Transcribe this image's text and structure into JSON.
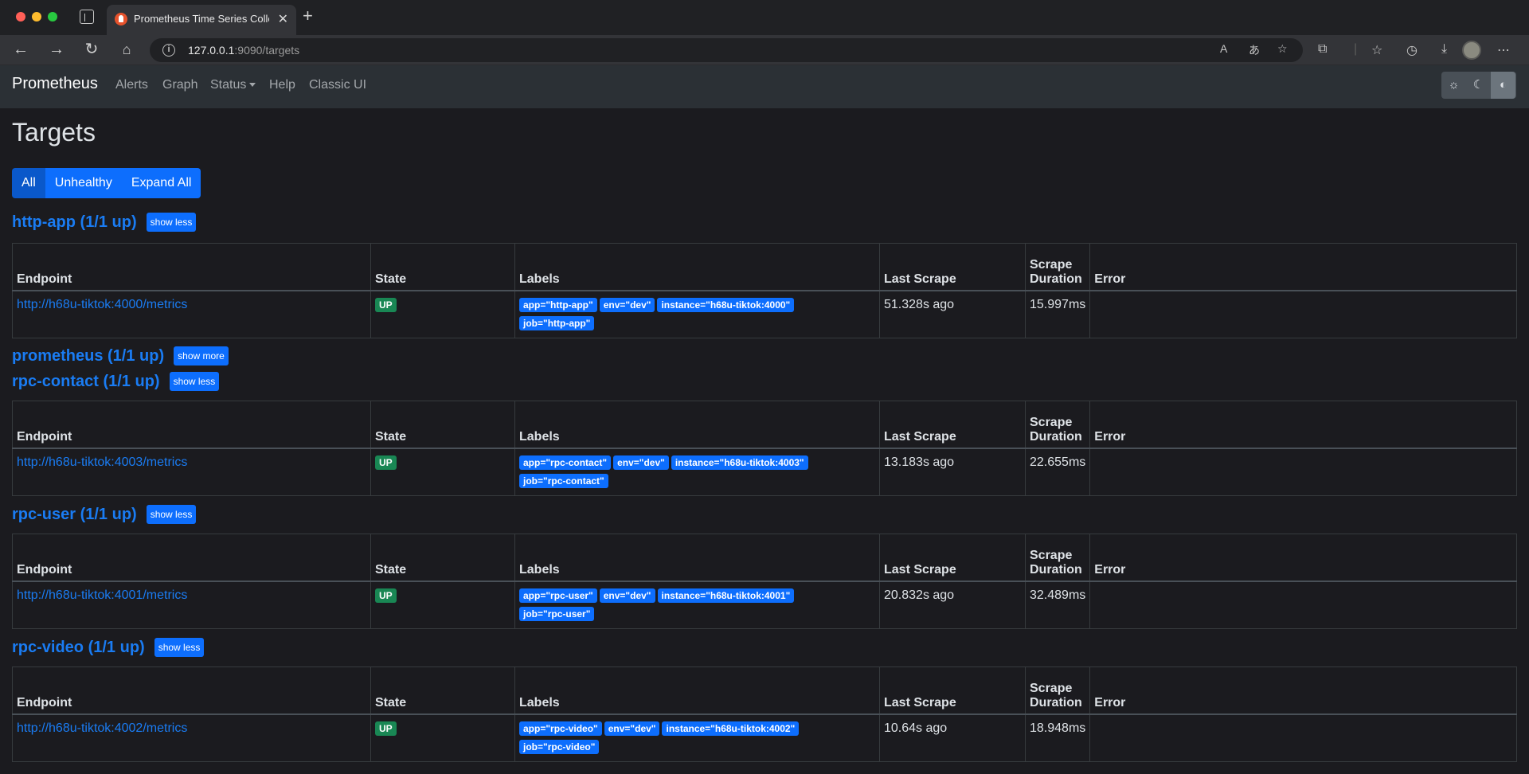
{
  "browser": {
    "tab_title": "Prometheus Time Series Collection and Processing Server",
    "url_host": "127.0.0.1",
    "url_rest": ":9090/targets"
  },
  "navbar": {
    "brand": "Prometheus",
    "links": [
      "Alerts",
      "Graph",
      "Status",
      "Help",
      "Classic UI"
    ]
  },
  "page": {
    "title": "Targets",
    "filters": [
      "All",
      "Unhealthy",
      "Expand All"
    ],
    "active_filter": "All"
  },
  "table_headers": {
    "endpoint": "Endpoint",
    "state": "State",
    "labels": "Labels",
    "last_scrape": "Last Scrape",
    "scrape_duration_1": "Scrape",
    "scrape_duration_2": "Duration",
    "error": "Error"
  },
  "pools": [
    {
      "title": "http-app (1/1 up)",
      "toggle": "show less",
      "endpoint": "http://h68u-tiktok:4000/metrics",
      "state": "UP",
      "labels": [
        "app=\"http-app\"",
        "env=\"dev\"",
        "instance=\"h68u-tiktok:4000\"",
        "job=\"http-app\""
      ],
      "last_scrape": "51.328s ago",
      "duration": "15.997ms",
      "error": ""
    },
    {
      "title": "prometheus (1/1 up)",
      "toggle": "show more"
    },
    {
      "title": "rpc-contact (1/1 up)",
      "toggle": "show less",
      "endpoint": "http://h68u-tiktok:4003/metrics",
      "state": "UP",
      "labels": [
        "app=\"rpc-contact\"",
        "env=\"dev\"",
        "instance=\"h68u-tiktok:4003\"",
        "job=\"rpc-contact\""
      ],
      "last_scrape": "13.183s ago",
      "duration": "22.655ms",
      "error": ""
    },
    {
      "title": "rpc-user (1/1 up)",
      "toggle": "show less",
      "endpoint": "http://h68u-tiktok:4001/metrics",
      "state": "UP",
      "labels": [
        "app=\"rpc-user\"",
        "env=\"dev\"",
        "instance=\"h68u-tiktok:4001\"",
        "job=\"rpc-user\""
      ],
      "last_scrape": "20.832s ago",
      "duration": "32.489ms",
      "error": ""
    },
    {
      "title": "rpc-video (1/1 up)",
      "toggle": "show less",
      "endpoint": "http://h68u-tiktok:4002/metrics",
      "state": "UP",
      "labels": [
        "app=\"rpc-video\"",
        "env=\"dev\"",
        "instance=\"h68u-tiktok:4002\"",
        "job=\"rpc-video\""
      ],
      "last_scrape": "10.64s ago",
      "duration": "18.948ms",
      "error": ""
    }
  ]
}
